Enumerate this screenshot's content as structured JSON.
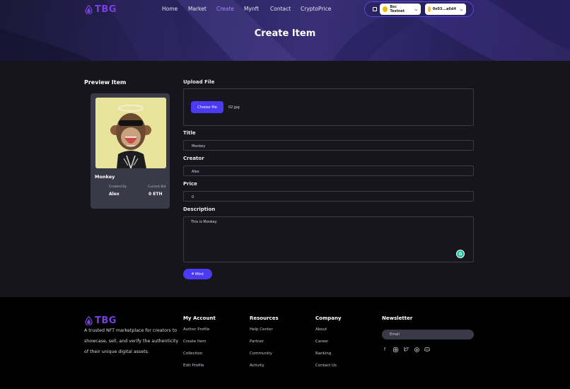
{
  "brand": {
    "name": "TBG",
    "accent": "#7a3fe0"
  },
  "nav": {
    "items": [
      "Home",
      "Market",
      "Create",
      "Mynft",
      "Contact",
      "CryptoPrice"
    ],
    "active": "Create"
  },
  "wallet": {
    "network": "Bsc Testnet",
    "account": "0x03...a6d4"
  },
  "hero": {
    "title": "Create Item"
  },
  "preview": {
    "heading": "Preview Item",
    "item_name": "Monkey",
    "created_by_label": "Created By",
    "created_by_value": "Alex",
    "bid_label": "Current Bid",
    "bid_value": "0 ETH"
  },
  "form": {
    "upload_label": "Upload File",
    "choose_file_label": "Choose file",
    "file_name": "02.jpg",
    "title_label": "Title",
    "title_value": "Monkey",
    "creator_label": "Creator",
    "creator_value": "Alex",
    "price_label": "Price",
    "price_value": "0",
    "description_label": "Description",
    "description_value": "This is Monkey",
    "mint_label": "Mint"
  },
  "footer": {
    "tagline": "A trusted NFT marketplace for creators to showcase, sell, and verify the authenticity of their unique digital assets.",
    "columns": [
      {
        "heading": "My Account",
        "links": [
          "Author Profile",
          "Create Item",
          "Collection",
          "Edit Profile"
        ]
      },
      {
        "heading": "Resources",
        "links": [
          "Help Center",
          "Partner",
          "Community",
          "Activity"
        ]
      },
      {
        "heading": "Company",
        "links": [
          "About",
          "Career",
          "Ranking",
          "Contact Us"
        ]
      }
    ],
    "newsletter": {
      "heading": "Newsletter",
      "placeholder": "Email"
    },
    "social_icons": [
      "facebook-icon",
      "instagram-icon",
      "twitter-icon",
      "reddit-icon",
      "discord-icon"
    ]
  },
  "colors": {
    "primary_button": "#4b3af2",
    "page_bg": "#16151c",
    "footer_bg": "#000000"
  }
}
